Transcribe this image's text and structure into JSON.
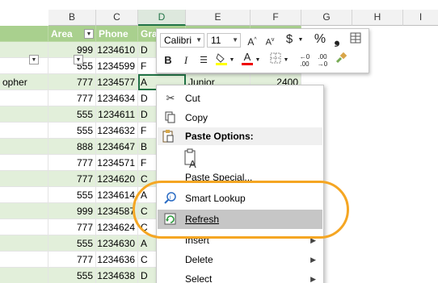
{
  "columns": [
    "B",
    "C",
    "D",
    "E",
    "F",
    "G",
    "H",
    "I"
  ],
  "headers": [
    "Area",
    "Phone",
    "Gra"
  ],
  "row3_a": "opher",
  "row3_e": "Junior",
  "row3_f": "2400",
  "rows": [
    {
      "area": "999",
      "phone": "1234610",
      "grade": "D"
    },
    {
      "area": "555",
      "phone": "1234599",
      "grade": "F"
    },
    {
      "area": "777",
      "phone": "1234577",
      "grade": "A"
    },
    {
      "area": "777",
      "phone": "1234634",
      "grade": "D"
    },
    {
      "area": "555",
      "phone": "1234611",
      "grade": "D"
    },
    {
      "area": "555",
      "phone": "1234632",
      "grade": "F"
    },
    {
      "area": "888",
      "phone": "1234647",
      "grade": "B"
    },
    {
      "area": "777",
      "phone": "1234571",
      "grade": "F"
    },
    {
      "area": "777",
      "phone": "1234620",
      "grade": "C"
    },
    {
      "area": "555",
      "phone": "1234614",
      "grade": "A"
    },
    {
      "area": "999",
      "phone": "1234587",
      "grade": "C"
    },
    {
      "area": "777",
      "phone": "1234624",
      "grade": "C"
    },
    {
      "area": "555",
      "phone": "1234630",
      "grade": "A"
    },
    {
      "area": "777",
      "phone": "1234636",
      "grade": "C"
    },
    {
      "area": "555",
      "phone": "1234638",
      "grade": "D"
    }
  ],
  "mini_toolbar": {
    "font": "Calibri",
    "size": "11"
  },
  "menu": {
    "cut": "Cut",
    "copy": "Copy",
    "paste_options": "Paste Options:",
    "paste_special": "Paste Special...",
    "smart_lookup": "Smart Lookup",
    "refresh": "Refresh",
    "insert": "Insert",
    "delete": "Delete",
    "select": "Select"
  },
  "colors": {
    "header_green": "#a9d08e",
    "band_green": "#e2efda",
    "highlight": "#c6c6c6",
    "callout": "#f5a623"
  }
}
